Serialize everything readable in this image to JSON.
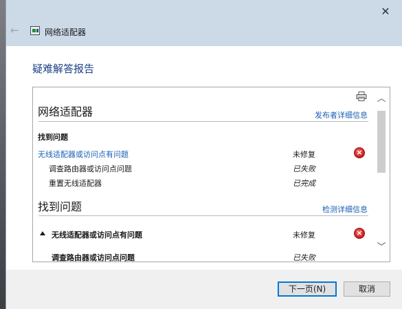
{
  "window": {
    "title": "网络适配器",
    "close_symbol": "✕",
    "back_symbol": "←"
  },
  "page": {
    "heading": "疑难解答报告"
  },
  "report": {
    "section1": {
      "title": "网络适配器",
      "link": "发布者详细信息",
      "sub_heading": "找到问题",
      "issue": {
        "label": "无线适配器或访问点有问题",
        "status": "未修复",
        "icon": "error-icon"
      },
      "steps": [
        {
          "label": "调查路由器或访问点问题",
          "status": "已失败"
        },
        {
          "label": "重置无线适配器",
          "status": "已完成"
        }
      ]
    },
    "section2": {
      "title": "找到问题",
      "link": "检测详细信息",
      "issue": {
        "label": "无线适配器或访问点有问题",
        "status": "未修复",
        "icon": "error-icon"
      },
      "step": {
        "label": "调查路由器或访问点问题",
        "status": "已失败"
      }
    }
  },
  "scrollbar": {
    "up_symbol": "︿",
    "down_symbol": "﹀"
  },
  "footer": {
    "next_label": "下一页(N)",
    "cancel_label": "取消"
  },
  "colors": {
    "titlebar": "#ccdae8",
    "heading_blue": "#1e3f87",
    "link_blue": "#1a5fb4",
    "error_red": "#d32222",
    "primary_border": "#0078d7"
  }
}
